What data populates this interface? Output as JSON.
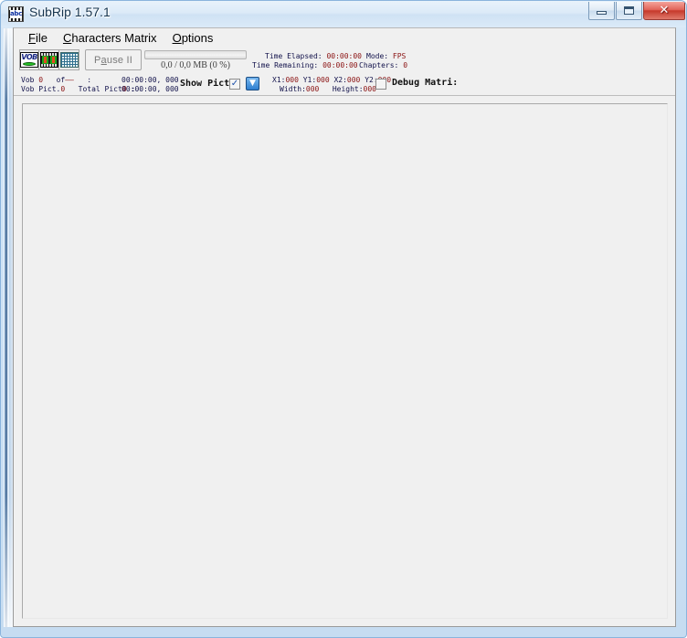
{
  "window": {
    "title": "SubRip 1.57.1",
    "app_icon": "abc",
    "controls": {
      "minimize": "minimize-icon",
      "maximize": "maximize-icon",
      "close": "✕"
    }
  },
  "menu": {
    "items": [
      {
        "label": "File",
        "mnemonic": "F"
      },
      {
        "label": "Characters Matrix",
        "mnemonic": "C"
      },
      {
        "label": "Options",
        "mnemonic": "O"
      }
    ]
  },
  "toolbar": {
    "buttons": [
      {
        "name": "open-vob-button",
        "icon": "vob-icon",
        "caption": "VOB"
      },
      {
        "name": "open-film-button",
        "icon": "film-strip-icon"
      },
      {
        "name": "characters-matrix-button",
        "icon": "matrix-grid-icon"
      }
    ],
    "pause_label": "Pause",
    "pause_glyph": "II",
    "pause_mnemonic": "a",
    "progress": {
      "percent": 0,
      "label": "0,0 / 0,0 MB (0 %)"
    },
    "stats": {
      "time_elapsed_label": "Time Elapsed:",
      "time_elapsed_value": "00:00:00",
      "time_remaining_label": "Time Remaining:",
      "time_remaining_value": "00:00:00",
      "mode_label": "Mode:",
      "mode_value": "FPS",
      "chapters_label": "Chapters:",
      "chapters_value": "0"
    }
  },
  "status": {
    "vob_label": "Vob",
    "vob_value": "0",
    "vob_of": "of",
    "vob_of_value": "——",
    "vob_colon": ":",
    "vob_pict_label": "Vob Pict.",
    "vob_pict_value": "0",
    "total_pict_label": "Total Pict",
    "total_pict_value": "0",
    "total_pict_colon": ":",
    "time_a": "00:00:00, 000",
    "time_b": "00:00:00, 000",
    "show_pict_label": "Show Pict.",
    "show_pict_checked": "✓",
    "dropdown_glyph": "▼",
    "coords": {
      "x1_label": "X1:",
      "x1_value": "000",
      "y1_label": "Y1:",
      "y1_value": "000",
      "x2_label": "X2:",
      "x2_value": "000",
      "y2_label": "Y2:",
      "y2_value": "000",
      "width_label": "Width:",
      "width_value": "000",
      "height_label": "Height:",
      "height_value": "000"
    },
    "debug_matrix_label": "Debug Matri:",
    "debug_matrix_checked": false
  },
  "colors": {
    "title_glass_top": "#e8f2fb",
    "title_glass_bottom": "#dbeaf8",
    "frame_border": "#8ab4dd",
    "close_button": "#c63a2c",
    "client_bg": "#f0f0f0",
    "canvas_bg": "#f0f0f0",
    "stat_label": "#11114a",
    "stat_value": "#8a1111",
    "accent_blue": "#2f7fd0"
  }
}
